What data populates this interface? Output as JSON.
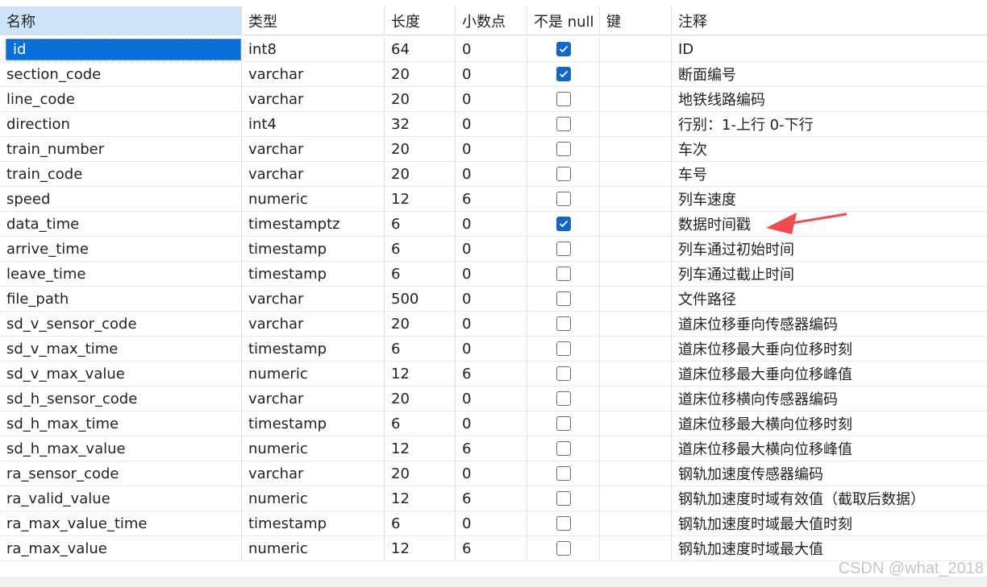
{
  "columns": {
    "name": "名称",
    "type": "类型",
    "length": "长度",
    "decimals": "小数点",
    "not_null": "不是 null",
    "key": "键",
    "comment": "注释"
  },
  "rows": [
    {
      "name": "id",
      "type": "int8",
      "length": "64",
      "decimals": "0",
      "not_null": true,
      "key": "",
      "comment": "ID"
    },
    {
      "name": "section_code",
      "type": "varchar",
      "length": "20",
      "decimals": "0",
      "not_null": true,
      "key": "",
      "comment": "断面编号"
    },
    {
      "name": "line_code",
      "type": "varchar",
      "length": "20",
      "decimals": "0",
      "not_null": false,
      "key": "",
      "comment": "地铁线路编码"
    },
    {
      "name": "direction",
      "type": "int4",
      "length": "32",
      "decimals": "0",
      "not_null": false,
      "key": "",
      "comment": "行别：1-上行 0-下行"
    },
    {
      "name": "train_number",
      "type": "varchar",
      "length": "20",
      "decimals": "0",
      "not_null": false,
      "key": "",
      "comment": "车次"
    },
    {
      "name": "train_code",
      "type": "varchar",
      "length": "20",
      "decimals": "0",
      "not_null": false,
      "key": "",
      "comment": "车号"
    },
    {
      "name": "speed",
      "type": "numeric",
      "length": "12",
      "decimals": "6",
      "not_null": false,
      "key": "",
      "comment": "列车速度"
    },
    {
      "name": "data_time",
      "type": "timestamptz",
      "length": "6",
      "decimals": "0",
      "not_null": true,
      "key": "",
      "comment": "数据时间戳"
    },
    {
      "name": "arrive_time",
      "type": "timestamp",
      "length": "6",
      "decimals": "0",
      "not_null": false,
      "key": "",
      "comment": "列车通过初始时间"
    },
    {
      "name": "leave_time",
      "type": "timestamp",
      "length": "6",
      "decimals": "0",
      "not_null": false,
      "key": "",
      "comment": "列车通过截止时间"
    },
    {
      "name": "file_path",
      "type": "varchar",
      "length": "500",
      "decimals": "0",
      "not_null": false,
      "key": "",
      "comment": "文件路径"
    },
    {
      "name": "sd_v_sensor_code",
      "type": "varchar",
      "length": "20",
      "decimals": "0",
      "not_null": false,
      "key": "",
      "comment": "道床位移垂向传感器编码"
    },
    {
      "name": "sd_v_max_time",
      "type": "timestamp",
      "length": "6",
      "decimals": "0",
      "not_null": false,
      "key": "",
      "comment": "道床位移最大垂向位移时刻"
    },
    {
      "name": "sd_v_max_value",
      "type": "numeric",
      "length": "12",
      "decimals": "6",
      "not_null": false,
      "key": "",
      "comment": "道床位移最大垂向位移峰值"
    },
    {
      "name": "sd_h_sensor_code",
      "type": "varchar",
      "length": "20",
      "decimals": "0",
      "not_null": false,
      "key": "",
      "comment": "道床位移横向传感器编码"
    },
    {
      "name": "sd_h_max_time",
      "type": "timestamp",
      "length": "6",
      "decimals": "0",
      "not_null": false,
      "key": "",
      "comment": "道床位移最大横向位移时刻"
    },
    {
      "name": "sd_h_max_value",
      "type": "numeric",
      "length": "12",
      "decimals": "6",
      "not_null": false,
      "key": "",
      "comment": "道床位移最大横向位移峰值"
    },
    {
      "name": "ra_sensor_code",
      "type": "varchar",
      "length": "20",
      "decimals": "0",
      "not_null": false,
      "key": "",
      "comment": "钢轨加速度传感器编码"
    },
    {
      "name": "ra_valid_value",
      "type": "numeric",
      "length": "12",
      "decimals": "6",
      "not_null": false,
      "key": "",
      "comment": "钢轨加速度时域有效值（截取后数据）"
    },
    {
      "name": "ra_max_value_time",
      "type": "timestamp",
      "length": "6",
      "decimals": "0",
      "not_null": false,
      "key": "",
      "comment": "钢轨加速度时域最大值时刻"
    },
    {
      "name": "ra_max_value",
      "type": "numeric",
      "length": "12",
      "decimals": "6",
      "not_null": false,
      "key": "",
      "comment": "钢轨加速度时域最大值"
    }
  ],
  "watermark": "CSDN @what_2018",
  "colors": {
    "selection": "#0a6ed8",
    "checkbox_checked": "#1268c6",
    "arrow": "#ef4d4d",
    "header_name_bg": "#cde3f7"
  },
  "icons": {
    "checkbox": "check-icon",
    "annotation": "red-arrow-icon"
  }
}
